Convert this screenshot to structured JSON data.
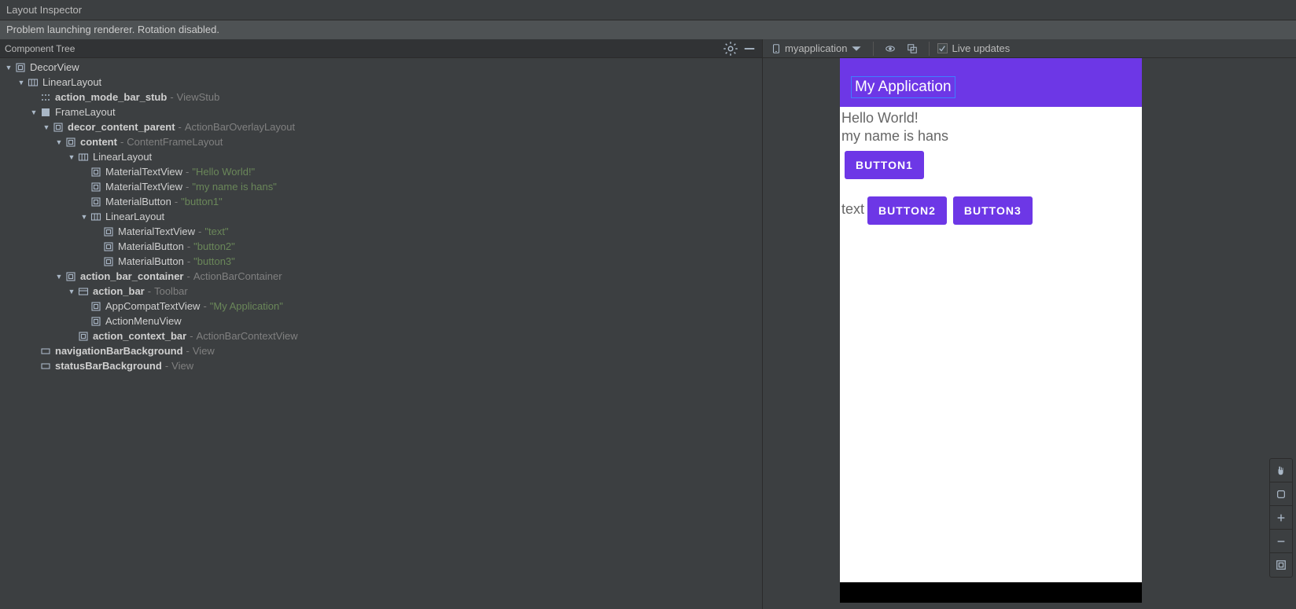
{
  "window": {
    "title": "Layout Inspector"
  },
  "status": {
    "message": "Problem launching renderer. Rotation disabled."
  },
  "tree_panel": {
    "title": "Component Tree"
  },
  "tree": [
    {
      "indent": 0,
      "twisty": "open",
      "icon": "frame",
      "name": "DecorView"
    },
    {
      "indent": 1,
      "twisty": "open",
      "icon": "linear",
      "name": "LinearLayout"
    },
    {
      "indent": 2,
      "twisty": "none",
      "icon": "stub",
      "name": "action_mode_bar_stub",
      "bold": true,
      "extra": "ViewStub"
    },
    {
      "indent": 2,
      "twisty": "open",
      "icon": "frame-solid",
      "name": "FrameLayout"
    },
    {
      "indent": 3,
      "twisty": "open",
      "icon": "frame",
      "name": "decor_content_parent",
      "bold": true,
      "extra": "ActionBarOverlayLayout"
    },
    {
      "indent": 4,
      "twisty": "open",
      "icon": "frame",
      "name": "content",
      "bold": true,
      "extra": "ContentFrameLayout"
    },
    {
      "indent": 5,
      "twisty": "open",
      "icon": "linear",
      "name": "LinearLayout"
    },
    {
      "indent": 6,
      "twisty": "none",
      "icon": "frame",
      "name": "MaterialTextView",
      "text": "\"Hello World!\""
    },
    {
      "indent": 6,
      "twisty": "none",
      "icon": "frame",
      "name": "MaterialTextView",
      "text": "\"my name is hans\""
    },
    {
      "indent": 6,
      "twisty": "none",
      "icon": "frame",
      "name": "MaterialButton",
      "text": "\"button1\""
    },
    {
      "indent": 6,
      "twisty": "open",
      "icon": "linear",
      "name": "LinearLayout"
    },
    {
      "indent": 7,
      "twisty": "none",
      "icon": "frame",
      "name": "MaterialTextView",
      "text": "\"text\""
    },
    {
      "indent": 7,
      "twisty": "none",
      "icon": "frame",
      "name": "MaterialButton",
      "text": "\"button2\""
    },
    {
      "indent": 7,
      "twisty": "none",
      "icon": "frame",
      "name": "MaterialButton",
      "text": "\"button3\""
    },
    {
      "indent": 4,
      "twisty": "open",
      "icon": "frame",
      "name": "action_bar_container",
      "bold": true,
      "extra": "ActionBarContainer"
    },
    {
      "indent": 5,
      "twisty": "open",
      "icon": "toolbar",
      "name": "action_bar",
      "bold": true,
      "extra": "Toolbar"
    },
    {
      "indent": 6,
      "twisty": "none",
      "icon": "frame",
      "name": "AppCompatTextView",
      "text": "\"My Application\""
    },
    {
      "indent": 6,
      "twisty": "none",
      "icon": "frame",
      "name": "ActionMenuView"
    },
    {
      "indent": 5,
      "twisty": "none",
      "icon": "frame",
      "name": "action_context_bar",
      "bold": true,
      "extra": "ActionBarContextView"
    },
    {
      "indent": 2,
      "twisty": "none",
      "icon": "rect",
      "name": "navigationBarBackground",
      "bold": true,
      "extra": "View"
    },
    {
      "indent": 2,
      "twisty": "none",
      "icon": "rect",
      "name": "statusBarBackground",
      "bold": true,
      "extra": "View"
    }
  ],
  "right_toolbar": {
    "process": "myapplication",
    "live_updates": "Live updates",
    "live_checked": true
  },
  "preview": {
    "app_title": "My Application",
    "line1": "Hello World!",
    "line2": "my name is hans",
    "button1": "BUTTON1",
    "row2_text": "text",
    "button2": "BUTTON2",
    "button3": "BUTTON3"
  }
}
